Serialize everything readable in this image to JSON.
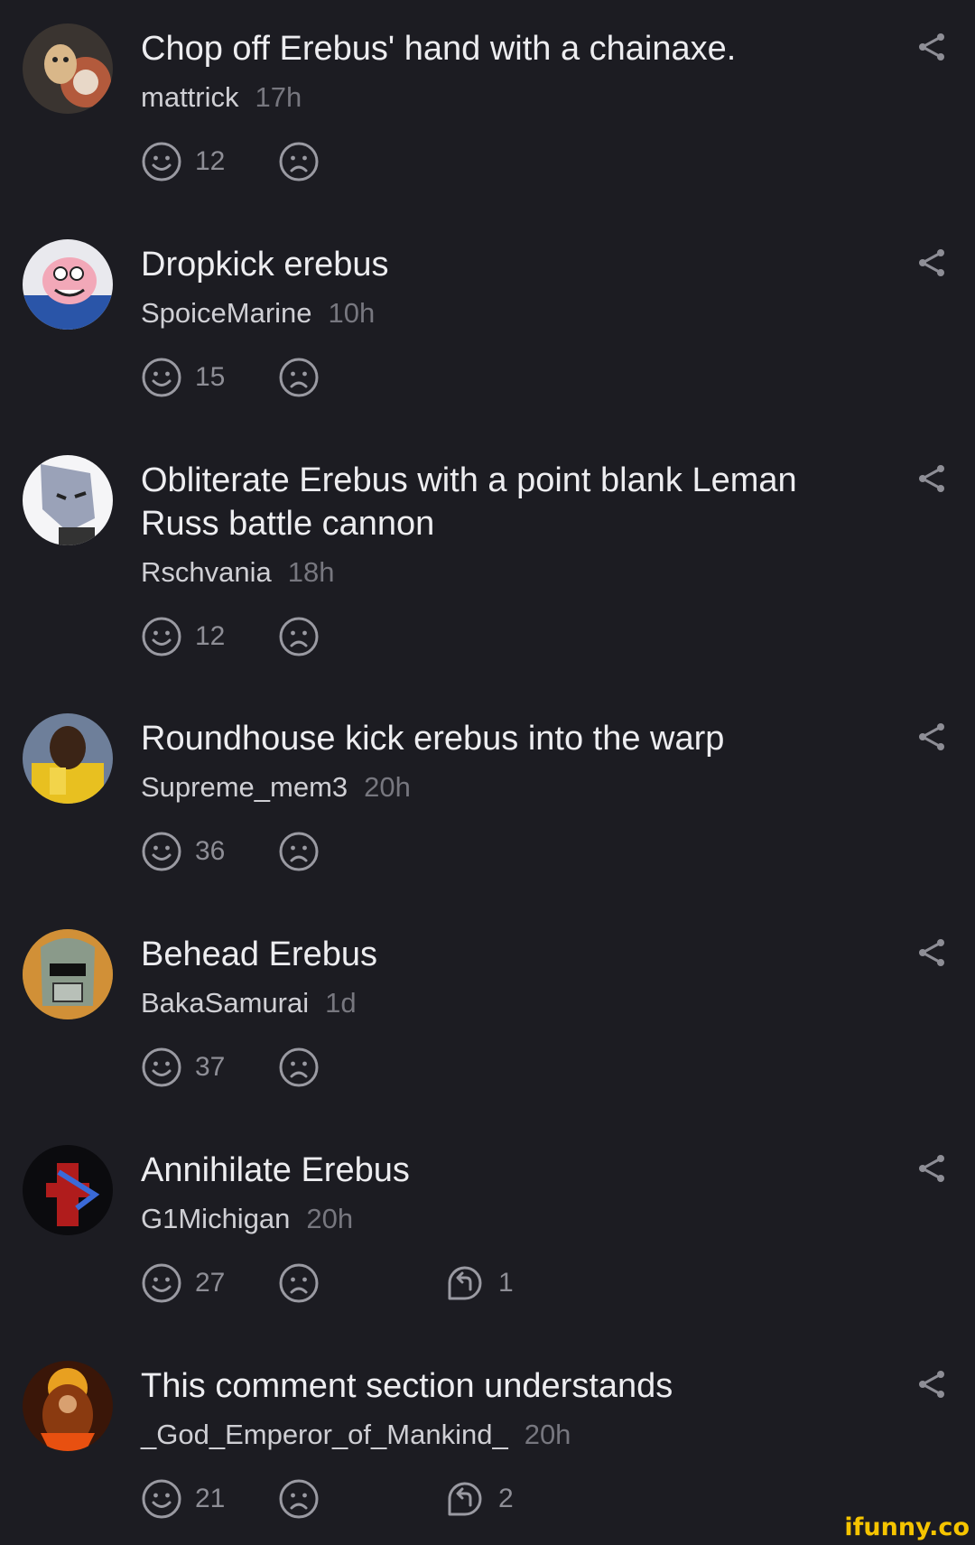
{
  "comments": [
    {
      "text": "Chop off Erebus' hand with a chainaxe.",
      "author": "mattrick",
      "time": "17h",
      "likes": "12",
      "replies": ""
    },
    {
      "text": "Dropkick erebus",
      "author": "SpoiceMarine",
      "time": "10h",
      "likes": "15",
      "replies": ""
    },
    {
      "text": "Obliterate Erebus with a point blank Leman Russ battle cannon",
      "author": "Rschvania",
      "time": "18h",
      "likes": "12",
      "replies": ""
    },
    {
      "text": "Roundhouse kick erebus into the warp",
      "author": "Supreme_mem3",
      "time": "20h",
      "likes": "36",
      "replies": ""
    },
    {
      "text": "Behead Erebus",
      "author": "BakaSamurai",
      "time": "1d",
      "likes": "37",
      "replies": ""
    },
    {
      "text": "Annihilate Erebus",
      "author": "G1Michigan",
      "time": "20h",
      "likes": "27",
      "replies": "1"
    },
    {
      "text": "This comment section understands",
      "author": "_God_Emperor_of_Mankind_",
      "time": "20h",
      "likes": "21",
      "replies": "2"
    }
  ],
  "icons": {
    "like": "smile-icon",
    "dislike": "frown-icon",
    "reply": "reply-icon",
    "share": "share-icon"
  },
  "watermark": "ifunny.co",
  "colors": {
    "background": "#1c1c22",
    "text": "#ededf0",
    "muted": "#77777f",
    "watermark": "#f5c400"
  }
}
